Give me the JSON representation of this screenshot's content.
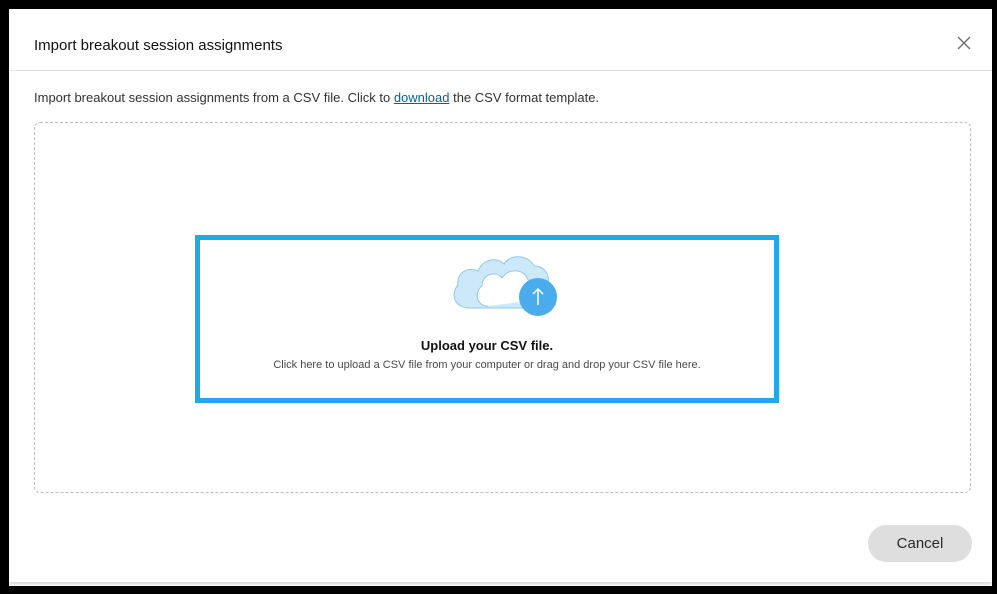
{
  "dialog": {
    "title": "Import breakout session assignments",
    "close_icon": "close-icon",
    "description_before": "Import breakout session assignments from a CSV file. Click to ",
    "description_link": "download",
    "description_after": " the CSV format template."
  },
  "upload": {
    "icon": "cloud-upload-icon",
    "title": "Upload your CSV file.",
    "subtitle": "Click here to upload a CSV file from your computer or drag and drop your CSV file here."
  },
  "footer": {
    "cancel_label": "Cancel"
  },
  "colors": {
    "highlight_border": "#1fa9e8",
    "upload_circle": "#4aabed",
    "cloud_fill": "#cde8f8",
    "link": "#0f5f8f"
  }
}
